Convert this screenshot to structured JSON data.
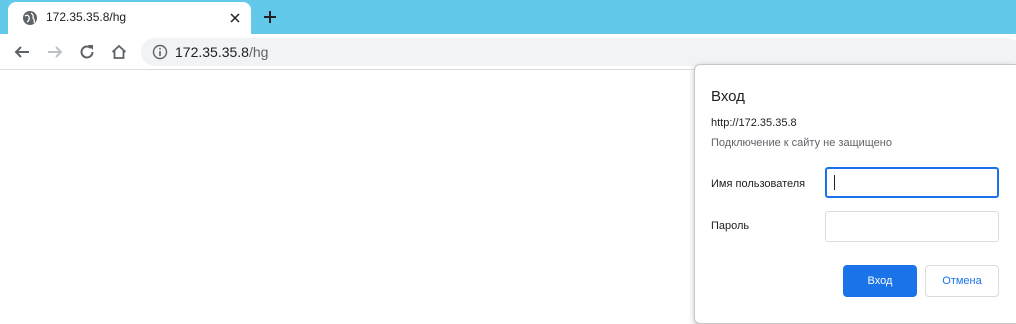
{
  "tab": {
    "title": "172.35.35.8/hg",
    "favicon_icon": "globe-icon",
    "close_icon": "close-icon"
  },
  "new_tab_icon": "plus-icon",
  "toolbar": {
    "back_icon": "arrow-left-icon",
    "forward_icon": "arrow-right-icon",
    "reload_icon": "reload-icon",
    "home_icon": "home-icon"
  },
  "omnibox": {
    "info_icon": "info-icon",
    "url_host": "172.35.35.8",
    "url_path": "/hg"
  },
  "dialog": {
    "title": "Вход",
    "origin": "http://172.35.35.8",
    "warning": "Подключение к сайту не защищено",
    "username_label": "Имя пользователя",
    "username_value": "",
    "password_label": "Пароль",
    "password_value": "",
    "login_button": "Вход",
    "cancel_button": "Отмена"
  },
  "colors": {
    "tabstrip": "#62c9ea",
    "accent": "#1a73e8",
    "omnibox": "#f1f3f4"
  }
}
